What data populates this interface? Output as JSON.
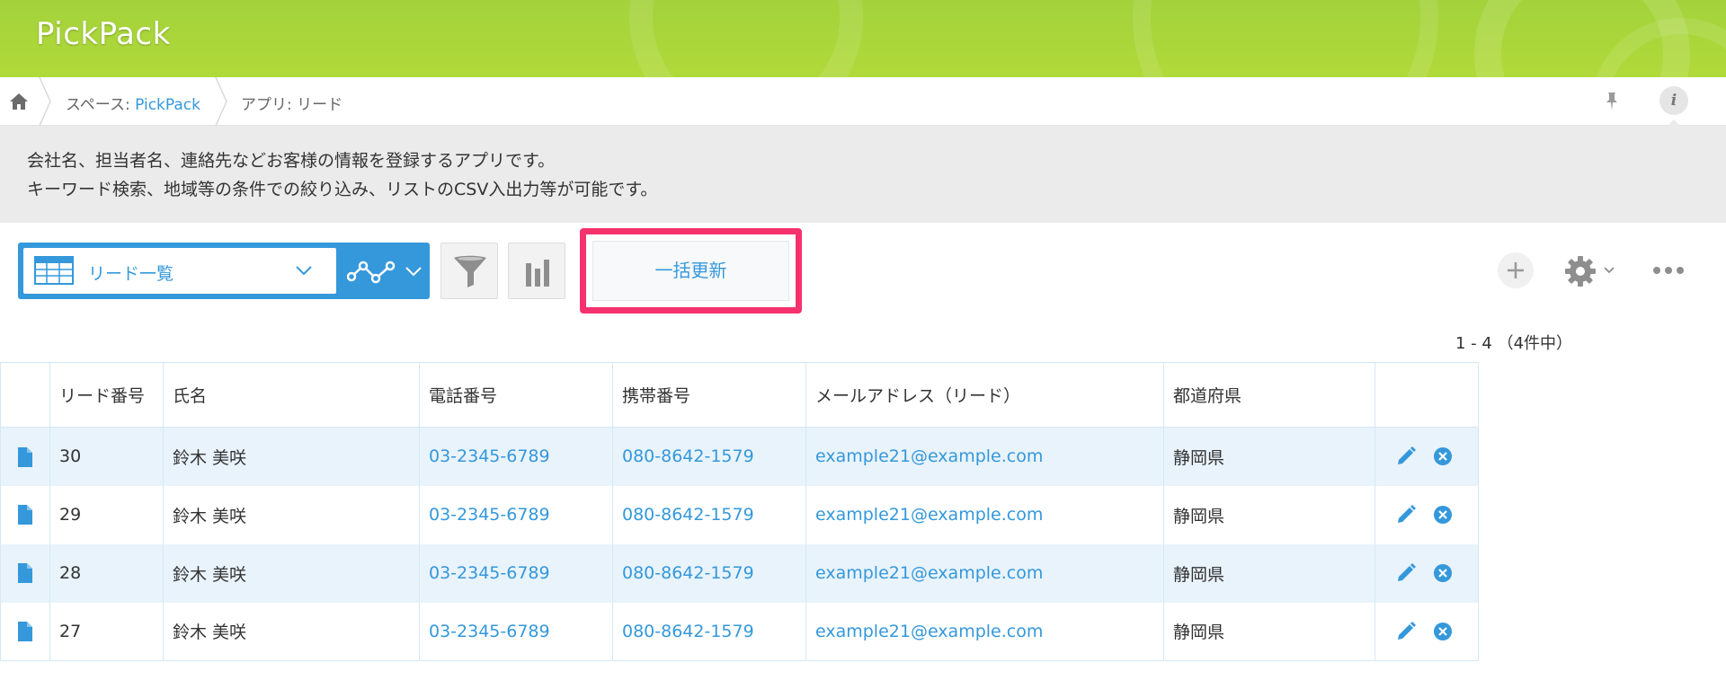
{
  "app": {
    "title": "PickPack"
  },
  "breadcrumb": {
    "space_prefix": "スペース: ",
    "space_name": "PickPack",
    "app_label": "アプリ: リード",
    "info_label": "i"
  },
  "description": {
    "line1": "会社名、担当者名、連絡先などお客様の情報を登録するアプリです。",
    "line2": "キーワード検索、地域等の条件での絞り込み、リストのCSV入出力等が可能です。"
  },
  "toolbar": {
    "view_name": "リード一覧",
    "bulk_update_label": "一括更新"
  },
  "pagination": {
    "text": "1 - 4 （4件中）"
  },
  "table": {
    "columns": [
      "リード番号",
      "氏名",
      "電話番号",
      "携帯番号",
      "メールアドレス（リード）",
      "都道府県"
    ],
    "rows": [
      {
        "id": "30",
        "name": "鈴木 美咲",
        "phone": "03-2345-6789",
        "mobile": "080-8642-1579",
        "email": "example21@example.com",
        "prefecture": "静岡県"
      },
      {
        "id": "29",
        "name": "鈴木 美咲",
        "phone": "03-2345-6789",
        "mobile": "080-8642-1579",
        "email": "example21@example.com",
        "prefecture": "静岡県"
      },
      {
        "id": "28",
        "name": "鈴木 美咲",
        "phone": "03-2345-6789",
        "mobile": "080-8642-1579",
        "email": "example21@example.com",
        "prefecture": "静岡県"
      },
      {
        "id": "27",
        "name": "鈴木 美咲",
        "phone": "03-2345-6789",
        "mobile": "080-8642-1579",
        "email": "example21@example.com",
        "prefecture": "静岡県"
      }
    ]
  },
  "icons": {
    "home": "home-icon",
    "pin": "pin-icon",
    "table_view": "table-view-icon",
    "graph": "graph-icon",
    "filter": "filter-icon",
    "chart": "bar-chart-icon",
    "add": "plus-icon",
    "settings": "gear-icon",
    "more": "more-icon",
    "record_detail": "document-icon",
    "edit": "pencil-icon",
    "delete": "close-circle-icon"
  },
  "colors": {
    "header_green": "#a3d23b",
    "accent_blue": "#3498db",
    "highlight_pink": "#f5326e",
    "row_stripe": "#e9f3fb"
  }
}
